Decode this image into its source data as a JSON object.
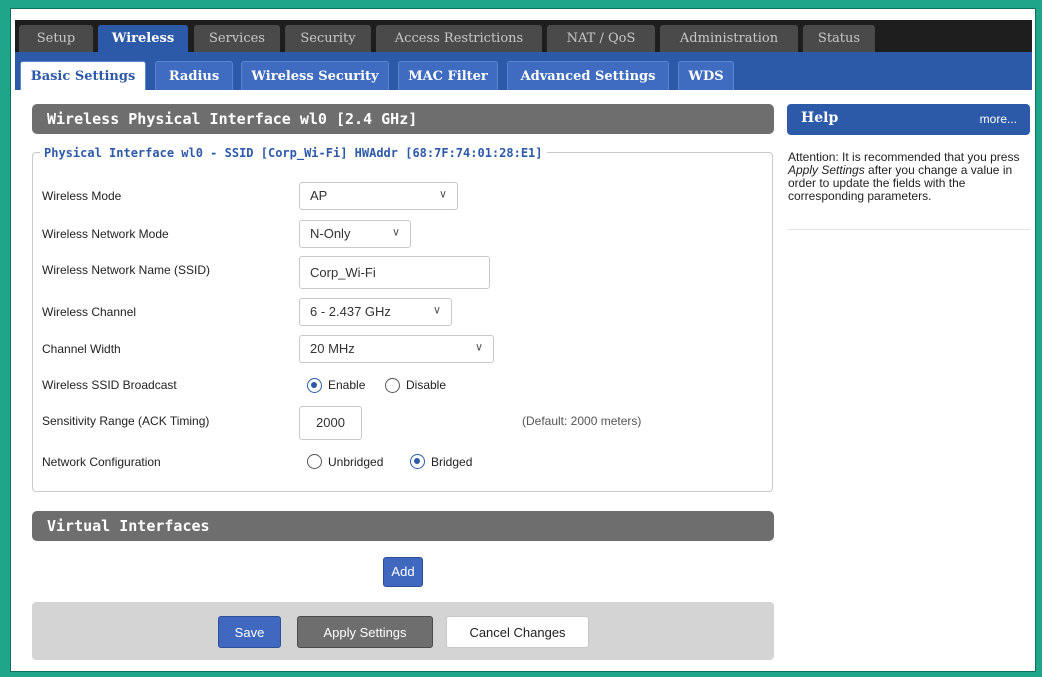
{
  "top_tabs": [
    "Setup",
    "Wireless",
    "Services",
    "Security",
    "Access Restrictions",
    "NAT / QoS",
    "Administration",
    "Status"
  ],
  "active_top_tab": "Wireless",
  "sub_tabs": [
    "Basic Settings",
    "Radius",
    "Wireless Security",
    "MAC Filter",
    "Advanced Settings",
    "WDS"
  ],
  "active_sub_tab": "Basic Settings",
  "physical_section": {
    "title": "Wireless Physical Interface wl0 [2.4 GHz]",
    "legend": "Physical Interface wl0 - SSID [Corp_Wi-Fi] HWAddr [68:7F:74:01:28:E1]"
  },
  "fields": {
    "wireless_mode": {
      "label": "Wireless Mode",
      "value": "AP"
    },
    "network_mode": {
      "label": "Wireless Network Mode",
      "value": "N-Only"
    },
    "ssid": {
      "label": "Wireless Network Name (SSID)",
      "value": "Corp_Wi-Fi"
    },
    "channel": {
      "label": "Wireless Channel",
      "value": "6 - 2.437 GHz"
    },
    "channel_width": {
      "label": "Channel Width",
      "value": "20 MHz"
    },
    "ssid_broadcast": {
      "label": "Wireless SSID Broadcast",
      "options": [
        "Enable",
        "Disable"
      ],
      "selected": "Enable"
    },
    "sensitivity": {
      "label": "Sensitivity Range (ACK Timing)",
      "value": "2000",
      "hint": "(Default: 2000 meters)"
    },
    "network_config": {
      "label": "Network Configuration",
      "options": [
        "Unbridged",
        "Bridged"
      ],
      "selected": "Bridged"
    }
  },
  "virtual_section": {
    "title": "Virtual Interfaces",
    "add_label": "Add"
  },
  "help": {
    "title": "Help",
    "more": "more...",
    "text_before": "Attention: It is recommended that you press ",
    "text_em": "Apply Settings",
    "text_after": " after you change a value in order to update the fields with the corresponding parameters."
  },
  "buttons": {
    "save": "Save",
    "apply": "Apply Settings",
    "cancel": "Cancel Changes"
  },
  "icons": {
    "dropdown": "chevron-down-icon"
  },
  "colors": {
    "accent": "#2d5aa8",
    "frame": "#1fa58a",
    "section_header": "#6e6e6e",
    "top_bar": "#1e1e1e"
  }
}
